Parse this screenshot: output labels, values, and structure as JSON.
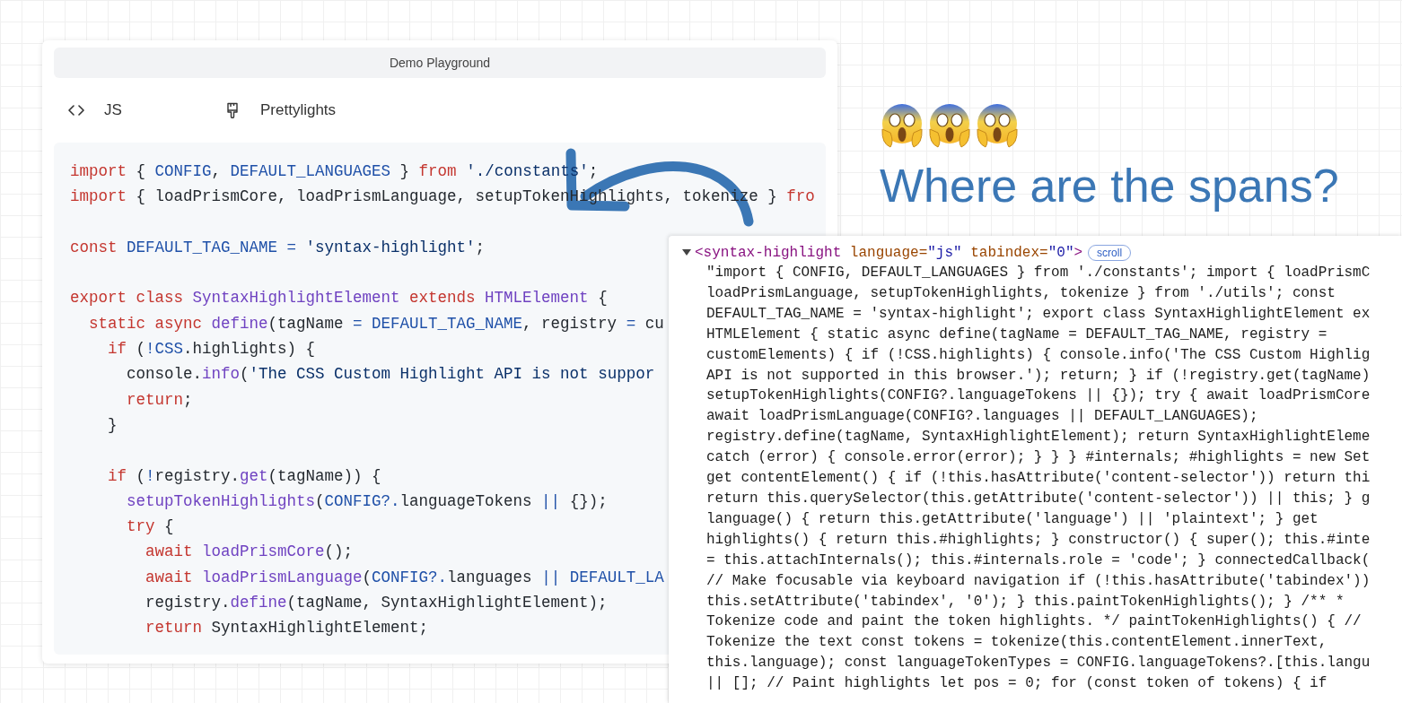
{
  "playground": {
    "title": "Demo Playground",
    "language": {
      "label": "JS"
    },
    "theme": {
      "label": "Prettylights"
    },
    "code_lines": [
      {
        "kind": "code",
        "tokens": [
          {
            "text": "import",
            "kind": "keyword"
          },
          {
            "text": " { ",
            "kind": "plain"
          },
          {
            "text": "CONFIG",
            "kind": "constant"
          },
          {
            "text": ", ",
            "kind": "plain"
          },
          {
            "text": "DEFAULT_LANGUAGES",
            "kind": "constant"
          },
          {
            "text": " } ",
            "kind": "plain"
          },
          {
            "text": "from",
            "kind": "keyword"
          },
          {
            "text": " './constants'",
            "kind": "string"
          },
          {
            "text": ";",
            "kind": "plain"
          }
        ]
      },
      {
        "kind": "code",
        "tokens": [
          {
            "text": "import",
            "kind": "keyword"
          },
          {
            "text": " { loadPrismCore, loadPrismLanguage, setupTokenHighlights, tokenize } ",
            "kind": "plain"
          },
          {
            "text": "fro",
            "kind": "keyword"
          }
        ]
      },
      {
        "kind": "blank"
      },
      {
        "kind": "code",
        "tokens": [
          {
            "text": "const",
            "kind": "keyword"
          },
          {
            "text": " DEFAULT_TAG_NAME = ",
            "kind": "constant"
          },
          {
            "text": "'syntax-highlight'",
            "kind": "string"
          },
          {
            "text": ";",
            "kind": "plain"
          }
        ]
      },
      {
        "kind": "blank"
      },
      {
        "kind": "code",
        "tokens": [
          {
            "text": "export class",
            "kind": "keyword"
          },
          {
            "text": " SyntaxHighlightElement ",
            "kind": "function"
          },
          {
            "text": "extends",
            "kind": "keyword"
          },
          {
            "text": " HTMLElement",
            "kind": "function"
          },
          {
            "text": " {",
            "kind": "plain"
          }
        ]
      },
      {
        "kind": "code",
        "tokens": [
          {
            "text": "  static async",
            "kind": "keyword"
          },
          {
            "text": " define",
            "kind": "function"
          },
          {
            "text": "(tagName ",
            "kind": "plain"
          },
          {
            "text": "= DEFAULT_TAG_NAME",
            "kind": "constant"
          },
          {
            "text": ", registry ",
            "kind": "plain"
          },
          {
            "text": "=",
            "kind": "constant"
          },
          {
            "text": " cu",
            "kind": "plain"
          }
        ]
      },
      {
        "kind": "code",
        "tokens": [
          {
            "text": "    if",
            "kind": "keyword"
          },
          {
            "text": " (",
            "kind": "plain"
          },
          {
            "text": "!CSS",
            "kind": "constant"
          },
          {
            "text": ".highlights) {",
            "kind": "plain"
          }
        ]
      },
      {
        "kind": "code",
        "tokens": [
          {
            "text": "      console.",
            "kind": "plain"
          },
          {
            "text": "info",
            "kind": "function"
          },
          {
            "text": "(",
            "kind": "plain"
          },
          {
            "text": "'The CSS Custom Highlight API is not suppor",
            "kind": "string"
          }
        ]
      },
      {
        "kind": "code",
        "tokens": [
          {
            "text": "      return",
            "kind": "keyword"
          },
          {
            "text": ";",
            "kind": "plain"
          }
        ]
      },
      {
        "kind": "code",
        "tokens": [
          {
            "text": "    }",
            "kind": "plain"
          }
        ]
      },
      {
        "kind": "blank"
      },
      {
        "kind": "code",
        "tokens": [
          {
            "text": "    if",
            "kind": "keyword"
          },
          {
            "text": " (",
            "kind": "plain"
          },
          {
            "text": "!",
            "kind": "constant"
          },
          {
            "text": "registry.",
            "kind": "plain"
          },
          {
            "text": "get",
            "kind": "function"
          },
          {
            "text": "(tagName)) {",
            "kind": "plain"
          }
        ]
      },
      {
        "kind": "code",
        "tokens": [
          {
            "text": "      setupTokenHighlights",
            "kind": "function"
          },
          {
            "text": "(",
            "kind": "plain"
          },
          {
            "text": "CONFIG?.",
            "kind": "constant"
          },
          {
            "text": "languageTokens ",
            "kind": "plain"
          },
          {
            "text": "||",
            "kind": "constant"
          },
          {
            "text": " {});",
            "kind": "plain"
          }
        ]
      },
      {
        "kind": "code",
        "tokens": [
          {
            "text": "      try",
            "kind": "keyword"
          },
          {
            "text": " {",
            "kind": "plain"
          }
        ]
      },
      {
        "kind": "code",
        "tokens": [
          {
            "text": "        await",
            "kind": "keyword"
          },
          {
            "text": " loadPrismCore",
            "kind": "function"
          },
          {
            "text": "();",
            "kind": "plain"
          }
        ]
      },
      {
        "kind": "code",
        "tokens": [
          {
            "text": "        await",
            "kind": "keyword"
          },
          {
            "text": " loadPrismLanguage",
            "kind": "function"
          },
          {
            "text": "(",
            "kind": "plain"
          },
          {
            "text": "CONFIG?.",
            "kind": "constant"
          },
          {
            "text": "languages ",
            "kind": "plain"
          },
          {
            "text": "|| DEFAULT_LA",
            "kind": "constant"
          }
        ]
      },
      {
        "kind": "code",
        "tokens": [
          {
            "text": "        registry.",
            "kind": "plain"
          },
          {
            "text": "define",
            "kind": "function"
          },
          {
            "text": "(tagName, SyntaxHighlightElement);",
            "kind": "plain"
          }
        ]
      },
      {
        "kind": "code",
        "tokens": [
          {
            "text": "        return",
            "kind": "keyword"
          },
          {
            "text": " SyntaxHighlightElement;",
            "kind": "plain"
          }
        ]
      }
    ]
  },
  "heading": {
    "title": "Where are the spans?"
  },
  "inspector": {
    "element": {
      "expanded": true,
      "tokens": [
        {
          "text": "<syntax-highlight",
          "kind": "tag"
        },
        {
          "text": " language=",
          "kind": "attribute"
        },
        {
          "text": "\"js\"",
          "kind": "value"
        },
        {
          "text": " tabindex=",
          "kind": "attribute"
        },
        {
          "text": "\"0\"",
          "kind": "value"
        },
        {
          "text": ">",
          "kind": "tag"
        }
      ],
      "badge": "scroll"
    },
    "text_lines": [
      "\"import { CONFIG, DEFAULT_LANGUAGES } from './constants'; import { loadPrismC",
      "loadPrismLanguage, setupTokenHighlights, tokenize } from './utils'; const",
      "DEFAULT_TAG_NAME = 'syntax-highlight'; export class SyntaxHighlightElement ex",
      "HTMLElement { static async define(tagName = DEFAULT_TAG_NAME, registry =",
      "customElements) { if (!CSS.highlights) { console.info('The CSS Custom Highlig",
      "API is not supported in this browser.'); return; } if (!registry.get(tagName)",
      "setupTokenHighlights(CONFIG?.languageTokens || {}); try { await loadPrismCore",
      "await loadPrismLanguage(CONFIG?.languages || DEFAULT_LANGUAGES);",
      "registry.define(tagName, SyntaxHighlightElement); return SyntaxHighlightEleme",
      "catch (error) { console.error(error); } } } #internals; #highlights = new Set",
      "get contentElement() { if (!this.hasAttribute('content-selector')) return thi",
      "return this.querySelector(this.getAttribute('content-selector')) || this; } g",
      "language() { return this.getAttribute('language') || 'plaintext'; } get",
      "highlights() { return this.#highlights; } constructor() { super(); this.#inte",
      "= this.attachInternals(); this.#internals.role = 'code'; } connectedCallback(",
      "// Make focusable via keyboard navigation if (!this.hasAttribute('tabindex'))",
      "this.setAttribute('tabindex', '0'); } this.paintTokenHighlights(); } /** *",
      "Tokenize code and paint the token highlights. */ paintTokenHighlights() { //",
      "Tokenize the text const tokens = tokenize(this.contentElement.innerText,",
      "this.language); const languageTokenTypes = CONFIG.languageTokens?.[this.langu",
      "|| []; // Paint highlights let pos = 0; for (const token of tokens) { if"
    ]
  }
}
